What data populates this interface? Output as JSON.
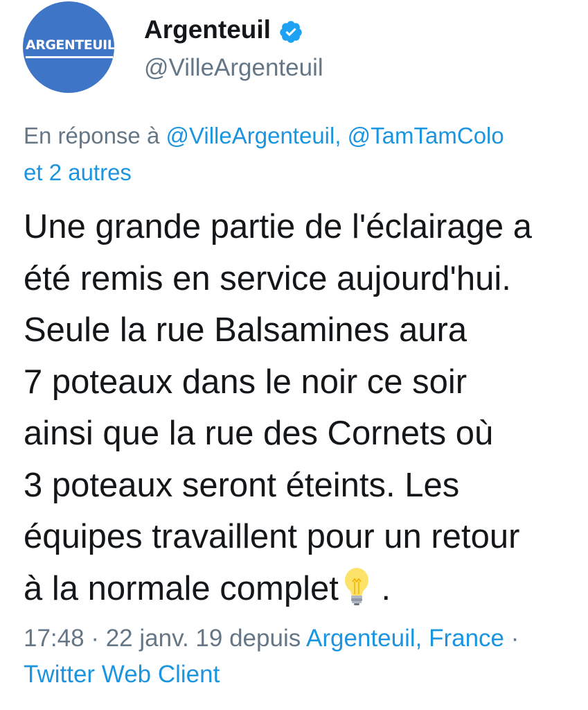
{
  "profile": {
    "avatar_text": "ARGENTEUIL",
    "display_name": "Argenteuil",
    "handle": "@VilleArgenteuil",
    "verified_icon": "verified-badge-icon"
  },
  "reply": {
    "prefix": "En réponse à ",
    "mentions": "@VilleArgenteuil, @TamTamColo",
    "others": "et 2 autres"
  },
  "tweet": {
    "lines": [
      "Une grande partie de l'éclairage a",
      "été remis en service aujourd'hui.",
      "Seule la rue Balsamines aura",
      "7 poteaux dans le noir ce soir",
      "ainsi que la rue des Cornets où",
      "3 poteaux seront éteints. Les",
      "équipes travaillent pour un retour",
      "à la normale complet"
    ],
    "end_punct": ".",
    "emoji_icon": "light-bulb-icon"
  },
  "meta": {
    "time": "17:48",
    "sep1": " · ",
    "date": "22 janv. 19",
    "via": " depuis ",
    "location": "Argenteuil, France",
    "sep2": " ·",
    "client": "Twitter Web Client"
  },
  "colors": {
    "link": "#1b95e0",
    "secondary": "#657786",
    "primary_text": "#14171a",
    "avatar_bg": "#3f75c6"
  }
}
